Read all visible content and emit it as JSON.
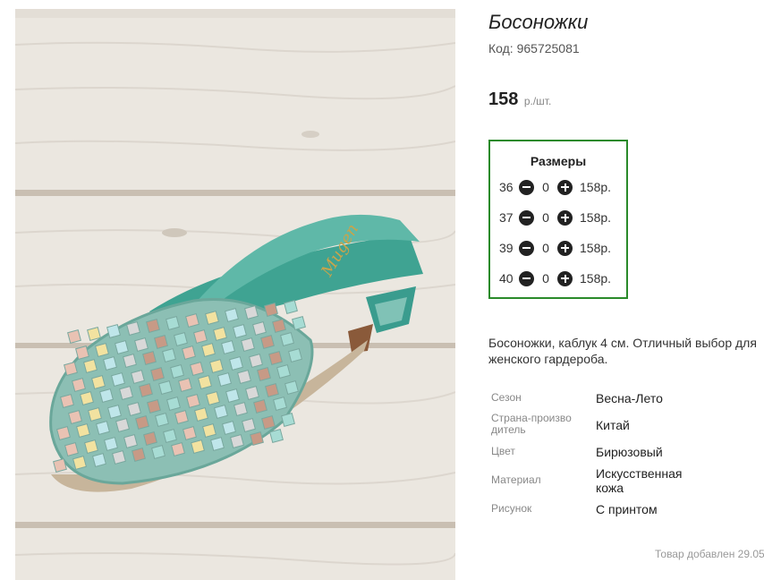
{
  "product": {
    "title": "Босоножки",
    "code_label": "Код:",
    "code": "965725081",
    "price": "158",
    "price_unit": "р./шт.",
    "image_brand_text": "Mugen"
  },
  "sizes": {
    "heading": "Размеры",
    "rows": [
      {
        "size": "36",
        "qty": "0",
        "price": "158р."
      },
      {
        "size": "37",
        "qty": "0",
        "price": "158р."
      },
      {
        "size": "39",
        "qty": "0",
        "price": "158р."
      },
      {
        "size": "40",
        "qty": "0",
        "price": "158р."
      }
    ]
  },
  "description": "Босоножки, каблук 4 см. Отличный выбор для женского гардероба.",
  "properties": [
    {
      "key": "Сезон",
      "value": "Весна-Лето"
    },
    {
      "key": "Страна-производитель",
      "value": "Китай"
    },
    {
      "key": "Цвет",
      "value": "Бирюзовый"
    },
    {
      "key": "Материал",
      "value": "Искусственная кожа"
    },
    {
      "key": "Рисунок",
      "value": "С принтом"
    }
  ],
  "footer": {
    "added": "Товар добавлен 29.05"
  },
  "colors": {
    "sizes_border": "#2a8a2a",
    "shoe": "#5fb8a8",
    "wood": "#ece8e1"
  }
}
